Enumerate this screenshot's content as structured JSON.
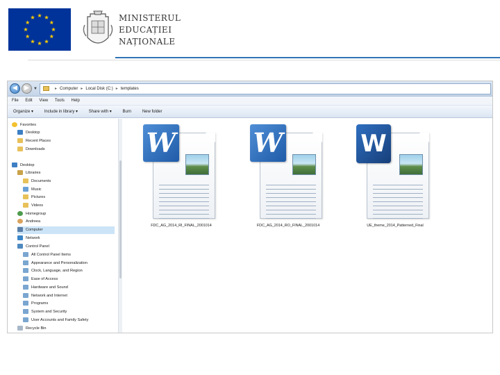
{
  "header": {
    "ministry_lines": [
      "MINISTERUL",
      "EDUCAȚIEI",
      "NAȚIONALE"
    ],
    "colors": {
      "eu_blue": "#003399",
      "eu_star": "#ffcc00",
      "rule": "#2e74b5"
    },
    "icons": [
      "eu-flag-icon",
      "coat-of-arms-icon"
    ]
  },
  "explorer": {
    "address": {
      "computer": "Computer",
      "disk": "Local Disk (C:)",
      "folder": "templates"
    },
    "menu": [
      "File",
      "Edit",
      "View",
      "Tools",
      "Help"
    ],
    "toolbar": {
      "organize": "Organize ▾",
      "include": "Include in library ▾",
      "share": "Share with ▾",
      "burn": "Burn",
      "new_folder": "New folder"
    },
    "nav": {
      "favorites": "Favorites",
      "desktop_fav": "Desktop",
      "recent": "Recent Places",
      "downloads": "Downloads",
      "desktop": "Desktop",
      "libraries": "Libraries",
      "documents": "Documents",
      "music": "Music",
      "pictures": "Pictures",
      "videos": "Videos",
      "homegroup": "Homegroup",
      "andreea": "Andreea",
      "computer": "Computer",
      "network": "Network",
      "control_panel": "Control Panel",
      "cp_all": "All Control Panel Items",
      "cp_appearance": "Appearance and Personalization",
      "cp_clock": "Clock, Language, and Region",
      "cp_ease": "Ease of Access",
      "cp_hardware": "Hardware and Sound",
      "cp_network": "Network and Internet",
      "cp_programs": "Programs",
      "cp_system": "System and Security",
      "cp_users": "User Accounts and Family Safety",
      "recycle_bin": "Recycle Bin"
    },
    "files": [
      {
        "name": "FDC_AG_2014_RI_FINAL_2001014",
        "icon": "word-doc-icon"
      },
      {
        "name": "FDC_AG_2014_RO_FINAL_2001014",
        "icon": "word-doc-icon"
      },
      {
        "name": "UE_theme_2014_Patterned_Final",
        "icon": "word-docx-icon"
      }
    ]
  }
}
